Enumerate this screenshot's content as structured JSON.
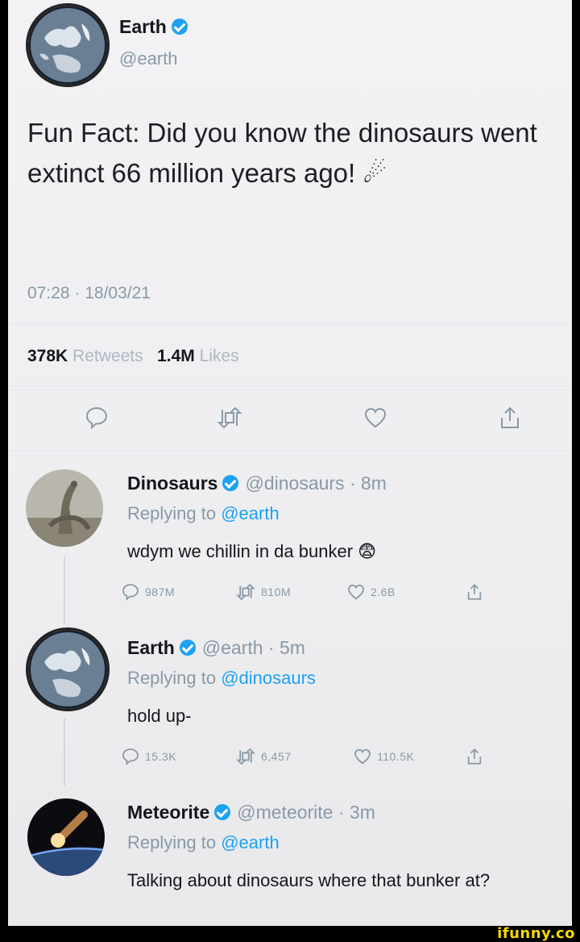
{
  "main_tweet": {
    "name": "Earth",
    "handle": "@earth",
    "text": "Fun Fact: Did you know the dinosaurs went extinct 66 million years ago! ☄",
    "timestamp": "07:28 · 18/03/21",
    "retweets_count": "378K",
    "retweets_label": "Retweets",
    "likes_count": "1.4M",
    "likes_label": "Likes"
  },
  "replies": [
    {
      "name": "Dinosaurs",
      "handle_time": "@dinosaurs · 8m",
      "replying_prefix": "Replying to",
      "replying_to": "@earth",
      "text": "wdym we chillin in da bunker 😨",
      "replies": "987M",
      "retweets": "810M",
      "likes": "2.6B"
    },
    {
      "name": "Earth",
      "handle_time": "@earth · 5m",
      "replying_prefix": "Replying to",
      "replying_to": "@dinosaurs",
      "text": "hold up-",
      "replies": "15.3K",
      "retweets": "6,457",
      "likes": "110.5K"
    },
    {
      "name": "Meteorite",
      "handle_time": "@meteorite · 3m",
      "replying_prefix": "Replying to",
      "replying_to": "@earth",
      "text": "Talking about dinosaurs where that bunker at?"
    }
  ],
  "watermark": "ifunny.co",
  "colors": {
    "accent": "#1da1f2",
    "muted": "#8899a6",
    "text": "#14171a",
    "watermark": "#f5d800"
  }
}
